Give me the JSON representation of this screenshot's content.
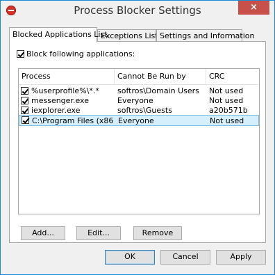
{
  "window": {
    "title": "Process Blocker Settings",
    "close_glyph": "×"
  },
  "tabs": [
    {
      "label": "Blocked Applications List",
      "active": true
    },
    {
      "label": "Exceptions List",
      "active": false
    },
    {
      "label": "Settings and Information",
      "active": false
    }
  ],
  "block_checkbox": {
    "label": "Block following applications:",
    "checked": true
  },
  "list": {
    "columns": [
      "Process",
      "Cannot Be Run by",
      "CRC"
    ],
    "rows": [
      {
        "checked": true,
        "process": "%userprofile%\\*.*",
        "run_by": "softros\\Domain Users",
        "crc": "Not used",
        "selected": false
      },
      {
        "checked": true,
        "process": "messenger.exe",
        "run_by": "Everyone",
        "crc": "Not used",
        "selected": false
      },
      {
        "checked": true,
        "process": "iexplorer.exe",
        "run_by": "softros\\Guests",
        "crc": "a20b571b",
        "selected": false
      },
      {
        "checked": true,
        "process": "C:\\Program Files (x86…",
        "run_by": "Everyone",
        "crc": "Not used",
        "selected": true
      }
    ]
  },
  "list_buttons": {
    "add": "Add...",
    "edit": "Edit...",
    "remove": "Remove"
  },
  "dialog_buttons": {
    "ok": "OK",
    "cancel": "Cancel",
    "apply": "Apply"
  },
  "colors": {
    "window_border": "#1a8ad4",
    "close_button": "#c7504a",
    "selection": "#d6effc",
    "selection_border": "#7dbbe0"
  },
  "icons": {
    "app": "stop-sign-icon",
    "check": "checkmark-icon"
  }
}
